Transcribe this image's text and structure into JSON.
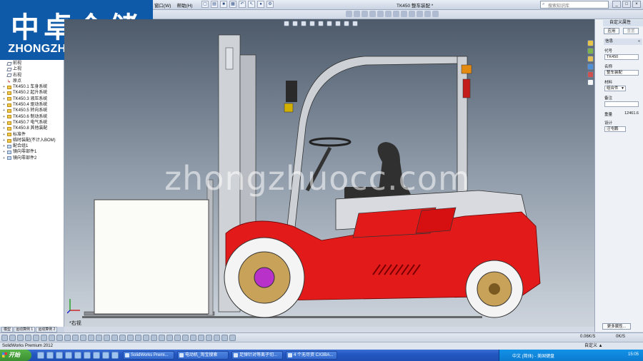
{
  "logo": {
    "cn": "中卓仓储",
    "en": "ZHONGZHUO STORAGE"
  },
  "titlebar": {
    "menu": [
      "窗口(W)",
      "帮助(H)"
    ],
    "doc_title": "TK450 整车装配 *",
    "search_placeholder": "搜索知识库",
    "win_min": "_",
    "win_max": "□",
    "win_close": "×"
  },
  "tree": {
    "items": [
      {
        "label": "前视",
        "icon": "plane",
        "exp": ""
      },
      {
        "label": "上视",
        "icon": "plane",
        "exp": ""
      },
      {
        "label": "右视",
        "icon": "plane",
        "exp": ""
      },
      {
        "label": "原点",
        "icon": "origin",
        "exp": ""
      },
      {
        "label": "TK450.1 车身系统",
        "icon": "folder",
        "exp": "+"
      },
      {
        "label": "TK450.2 起升系统",
        "icon": "folder",
        "exp": "+"
      },
      {
        "label": "TK450.3 液压系统",
        "icon": "folder",
        "exp": "+"
      },
      {
        "label": "TK450.4 驱动系统",
        "icon": "folder",
        "exp": "+"
      },
      {
        "label": "TK450.5 转向系统",
        "icon": "folder",
        "exp": "+"
      },
      {
        "label": "TK450.6 制动系统",
        "icon": "folder",
        "exp": "+"
      },
      {
        "label": "TK450.7 电气系统",
        "icon": "folder",
        "exp": "+"
      },
      {
        "label": "TK450.8 其他装配",
        "icon": "folder",
        "exp": "+"
      },
      {
        "label": "标准件",
        "icon": "folder",
        "exp": "+"
      },
      {
        "label": "临时装配(不计入BOM)",
        "icon": "folder",
        "exp": "+"
      },
      {
        "label": "配合组1",
        "icon": "part",
        "exp": "+"
      },
      {
        "label": "镜向零部件1",
        "icon": "part",
        "exp": "+"
      },
      {
        "label": "镜向零部件2",
        "icon": "part",
        "exp": "+"
      }
    ],
    "tabs": [
      "模型",
      "运动算例 1",
      "运动算例 2"
    ]
  },
  "viewport": {
    "watermark": "zhongzhuocc.com",
    "view_label": "*右视",
    "colors": {
      "body_red": "#e31a1a",
      "frame_grey": "#c6c9cf",
      "tire_white": "#f4f4f4",
      "hub_gold": "#c9a25a"
    }
  },
  "props": {
    "title": "自定义属性",
    "apply": "应用",
    "reset": "重置",
    "section": "信息",
    "section_close": "«",
    "code_label": "代号",
    "code_value": "TK450",
    "name_label": "名称",
    "name_value": "整车装配",
    "material_label": "材料",
    "material_value": "组合件",
    "note_label": "备注",
    "note_value": "",
    "weight_label": "重量",
    "weight_value": "12461.6",
    "design_label": "设计",
    "design_value": "汪屯鹏",
    "more_button": "更多属性..."
  },
  "cmdbar": {
    "speed": "0.06K/S",
    "rec": "0K/S"
  },
  "status": {
    "left": "SolidWorks Premium 2012",
    "right": "自定义 ▲"
  },
  "taskbar": {
    "start": "开始",
    "tasks": [
      "SolidWorks Premi...",
      "电动机_淘宝搜索",
      "足弹针对等离子切...",
      "4 个无尽资 CX3BA..."
    ],
    "ime": "中文 (简体) - 美国键盘",
    "clock": "15:05"
  }
}
